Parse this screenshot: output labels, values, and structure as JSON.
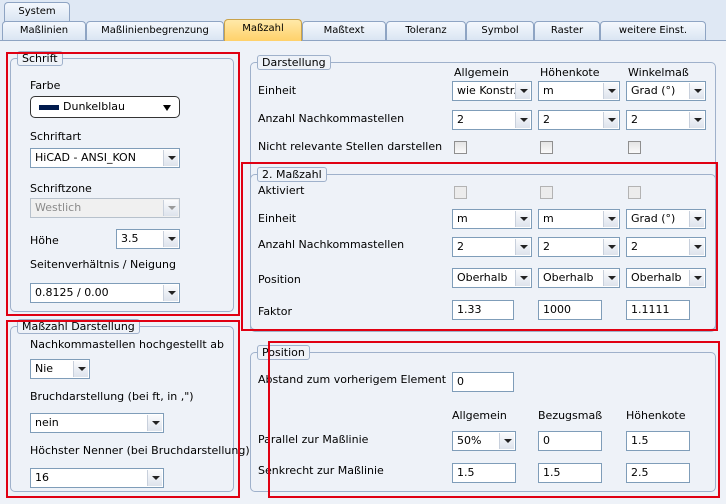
{
  "tabs": {
    "row1": [
      {
        "label": "System"
      }
    ],
    "row2": [
      {
        "label": "Maßlinien"
      },
      {
        "label": "Maßlinienbegrenzung"
      },
      {
        "label": "Maßzahl"
      },
      {
        "label": "Maßtext"
      },
      {
        "label": "Toleranz"
      },
      {
        "label": "Symbol"
      },
      {
        "label": "Raster"
      },
      {
        "label": "weitere Einst."
      }
    ],
    "active": "Maßzahl"
  },
  "schrift": {
    "title": "Schrift",
    "farbe_label": "Farbe",
    "farbe_value": "Dunkelblau",
    "farbe_color": "#001a4d",
    "schriftart_label": "Schriftart",
    "schriftart_value": "HiCAD - ANSI_KON",
    "schriftzone_label": "Schriftzone",
    "schriftzone_value": "Westlich",
    "hoehe_label": "Höhe",
    "hoehe_value": "3.5",
    "seiten_label": "Seitenverhältnis / Neigung",
    "seiten_value": "0.8125 / 0.00"
  },
  "masszahl_darstellung": {
    "title": "Maßzahl Darstellung",
    "nachkomma_label": "Nachkommastellen hochgestellt ab",
    "nachkomma_value": "Nie",
    "bruch_label": "Bruchdarstellung (bei ft, in ,\")",
    "bruch_value": "nein",
    "nenner_label": "Höchster Nenner (bei Bruchdarstellung)",
    "nenner_value": "16"
  },
  "darstellung": {
    "title": "Darstellung",
    "headers": [
      "Allgemein",
      "Höhenkote",
      "Winkelmaß"
    ],
    "einheit_label": "Einheit",
    "einheit_values": [
      "wie Konstr.",
      "m",
      "Grad (°)"
    ],
    "nachkomma_label": "Anzahl Nachkommastellen",
    "nachkomma_values": [
      "2",
      "2",
      "2"
    ],
    "nicht_relevant_label": "Nicht relevante Stellen darstellen"
  },
  "zweite_masszahl": {
    "title": "2. Maßzahl",
    "aktiviert_label": "Aktiviert",
    "einheit_label": "Einheit",
    "einheit_values": [
      "m",
      "m",
      "Grad (°)"
    ],
    "nachkomma_label": "Anzahl Nachkommastellen",
    "nachkomma_values": [
      "2",
      "2",
      "2"
    ],
    "position_label": "Position",
    "position_values": [
      "Oberhalb",
      "Oberhalb",
      "Oberhalb"
    ],
    "faktor_label": "Faktor",
    "faktor_values": [
      "1.33",
      "1000",
      "1.1111"
    ]
  },
  "position": {
    "title": "Position",
    "abstand_label": "Abstand zum vorherigem Element",
    "abstand_value": "0",
    "headers": [
      "Allgemein",
      "Bezugsmaß",
      "Höhenkote"
    ],
    "parallel_label": "Parallel zur Maßlinie",
    "parallel_values": [
      "50%",
      "0",
      "1.5"
    ],
    "senkrecht_label": "Senkrecht zur Maßlinie",
    "senkrecht_values": [
      "1.5",
      "1.5",
      "2.5"
    ]
  },
  "colors": {
    "highlight": "#e00012",
    "active_tab": "#ffd16a",
    "group_border": "#9fb1cb"
  }
}
